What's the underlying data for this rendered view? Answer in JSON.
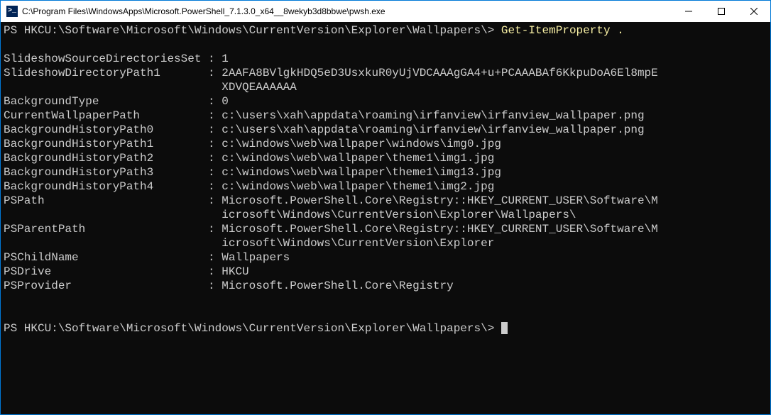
{
  "title": "C:\\Program Files\\WindowsApps\\Microsoft.PowerShell_7.1.3.0_x64__8wekyb3d8bbwe\\pwsh.exe",
  "prompt1": {
    "prefix": "PS HKCU:\\Software\\Microsoft\\Windows\\CurrentVersion\\Explorer\\Wallpapers\\> ",
    "command": "Get-ItemProperty ."
  },
  "output": [
    {
      "key": "SlideshowSourceDirectoriesSet",
      "value": "1"
    },
    {
      "key": "SlideshowDirectoryPath1",
      "value": "2AAFA8BVlgkHDQ5eD3UsxkuR0yUjVDCAAAgGA4+u+PCAAABAf6KkpuDoA6El8mpE",
      "cont": "XDVQEAAAAAA"
    },
    {
      "key": "BackgroundType",
      "value": "0"
    },
    {
      "key": "CurrentWallpaperPath",
      "value": "c:\\users\\xah\\appdata\\roaming\\irfanview\\irfanview_wallpaper.png"
    },
    {
      "key": "BackgroundHistoryPath0",
      "value": "c:\\users\\xah\\appdata\\roaming\\irfanview\\irfanview_wallpaper.png"
    },
    {
      "key": "BackgroundHistoryPath1",
      "value": "c:\\windows\\web\\wallpaper\\windows\\img0.jpg"
    },
    {
      "key": "BackgroundHistoryPath2",
      "value": "c:\\windows\\web\\wallpaper\\theme1\\img1.jpg"
    },
    {
      "key": "BackgroundHistoryPath3",
      "value": "c:\\windows\\web\\wallpaper\\theme1\\img13.jpg"
    },
    {
      "key": "BackgroundHistoryPath4",
      "value": "c:\\windows\\web\\wallpaper\\theme1\\img2.jpg"
    },
    {
      "key": "PSPath",
      "value": "Microsoft.PowerShell.Core\\Registry::HKEY_CURRENT_USER\\Software\\M",
      "cont": "icrosoft\\Windows\\CurrentVersion\\Explorer\\Wallpapers\\"
    },
    {
      "key": "PSParentPath",
      "value": "Microsoft.PowerShell.Core\\Registry::HKEY_CURRENT_USER\\Software\\M",
      "cont": "icrosoft\\Windows\\CurrentVersion\\Explorer"
    },
    {
      "key": "PSChildName",
      "value": "Wallpapers"
    },
    {
      "key": "PSDrive",
      "value": "HKCU"
    },
    {
      "key": "PSProvider",
      "value": "Microsoft.PowerShell.Core\\Registry"
    }
  ],
  "keyWidth": 29,
  "prompt2": {
    "prefix": "PS HKCU:\\Software\\Microsoft\\Windows\\CurrentVersion\\Explorer\\Wallpapers\\> "
  }
}
